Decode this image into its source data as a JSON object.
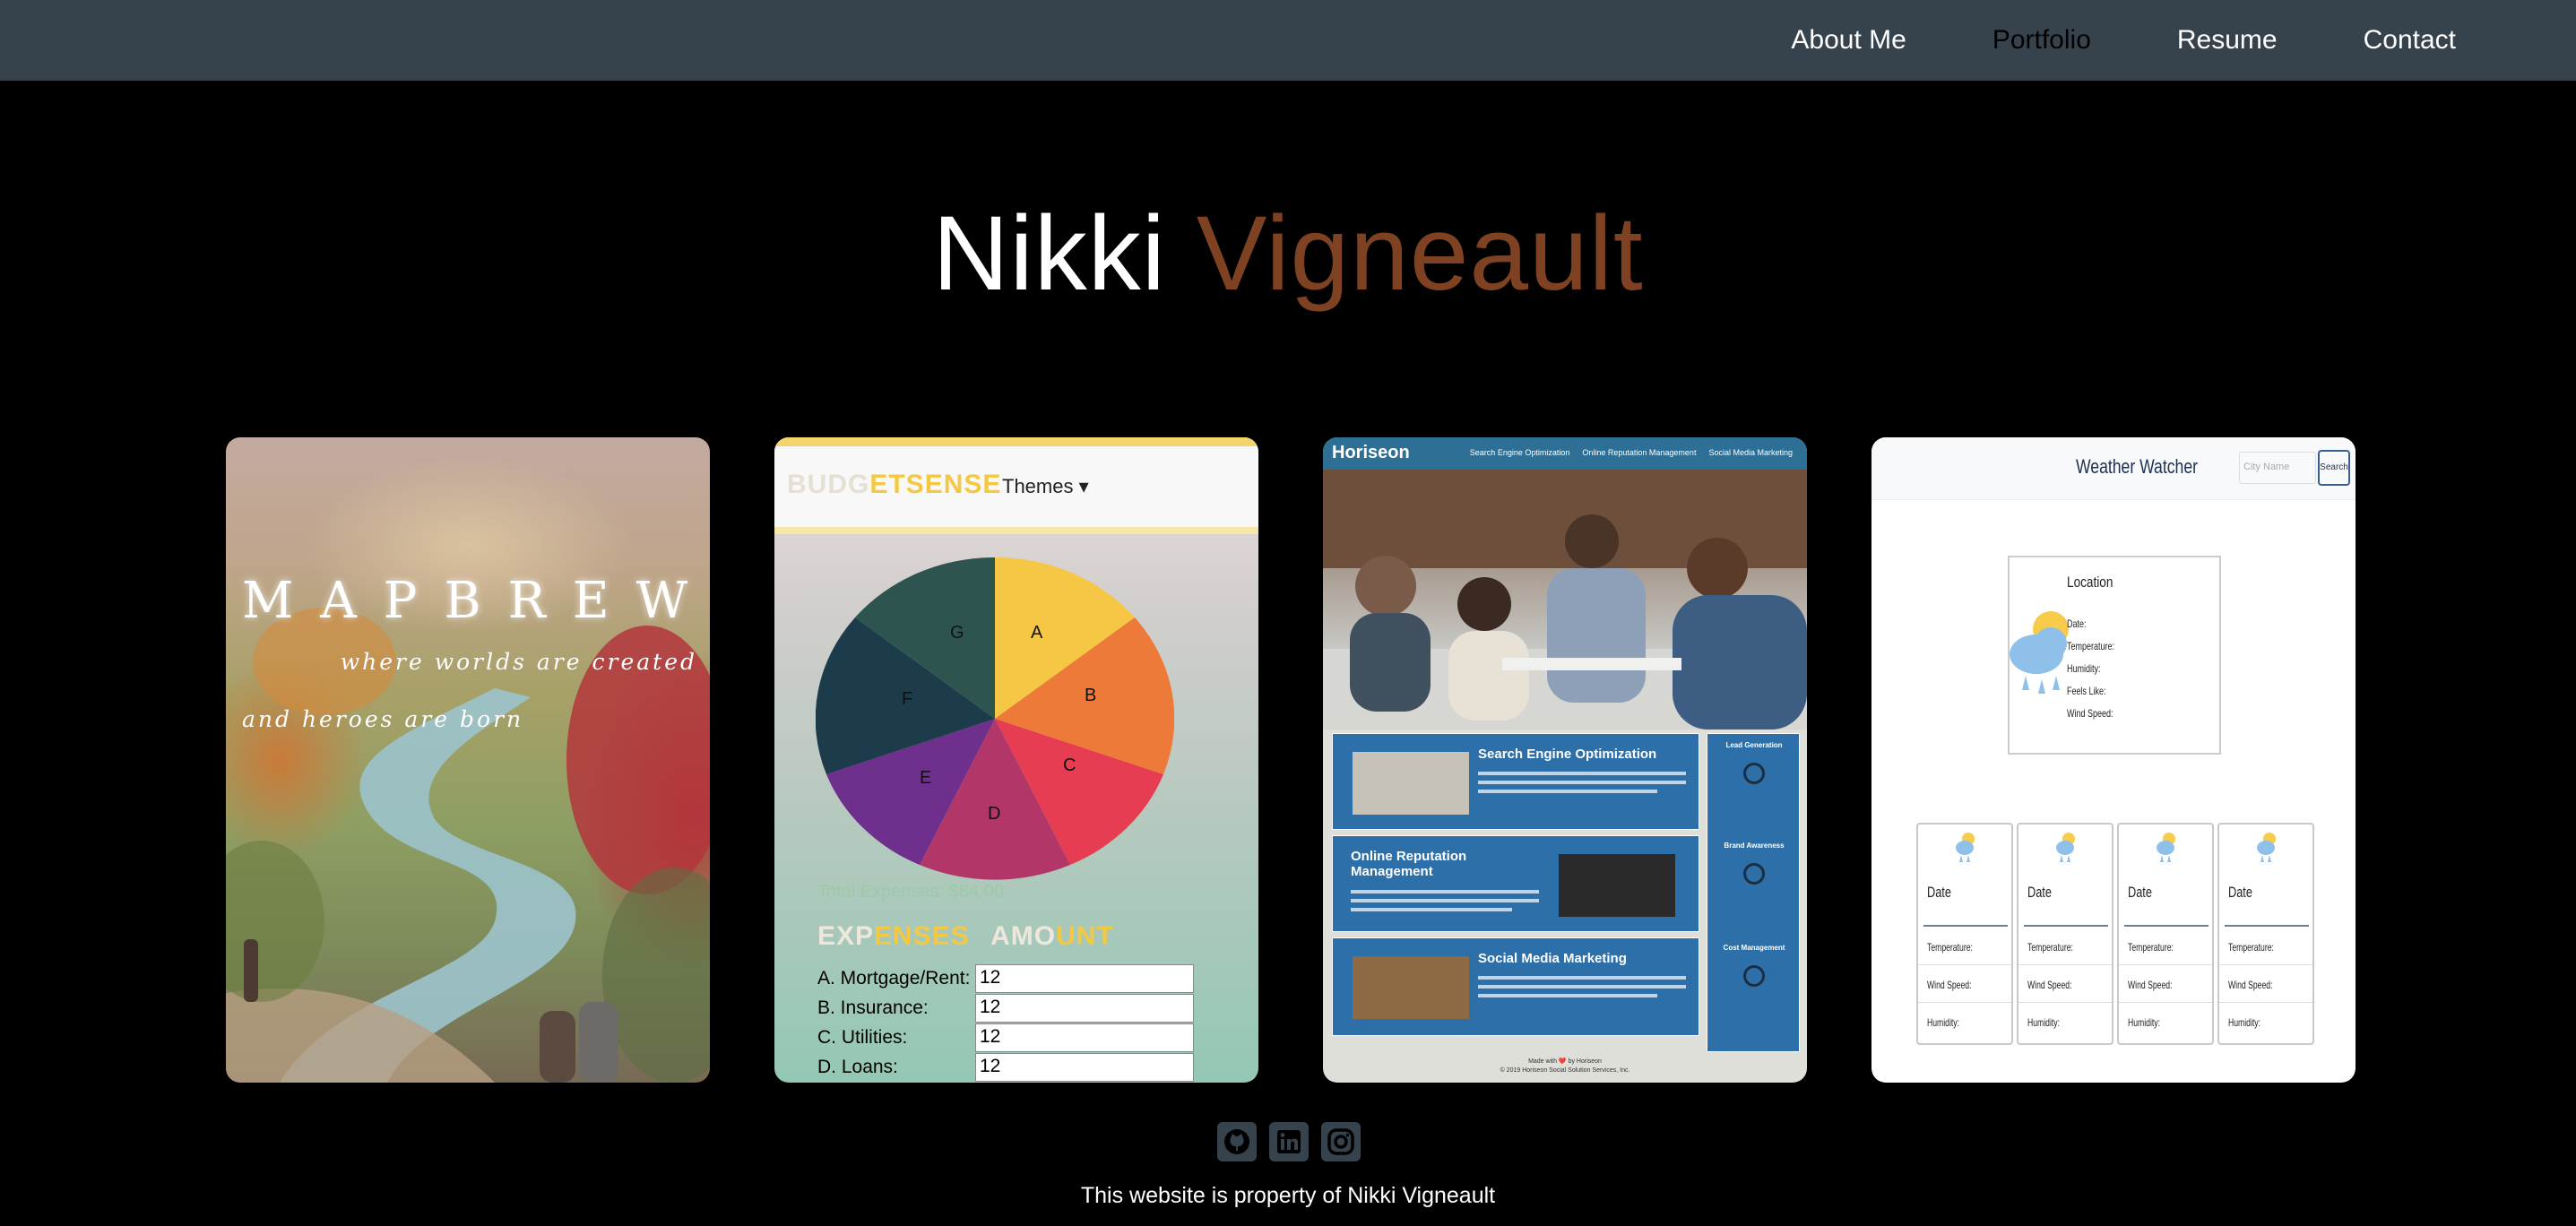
{
  "nav": {
    "links": [
      {
        "label": "About Me"
      },
      {
        "label": "Portfolio"
      },
      {
        "label": "Resume"
      },
      {
        "label": "Contact"
      }
    ]
  },
  "header": {
    "first_name": "Nikki",
    "last_name": "Vigneault"
  },
  "projects": {
    "mapbrew": {
      "title": "MAPBREW",
      "tagline1": "where worlds are created",
      "tagline2": "and heroes are born"
    },
    "budgetsense": {
      "logo_a": "BUDG",
      "logo_b": "ETSENSE",
      "themes_label": "Themes ▾",
      "pie_labels": [
        "A",
        "B",
        "C",
        "D",
        "E",
        "F",
        "G"
      ],
      "total": "Total Expenses: $84.00",
      "expenses_heading_a": "EXP",
      "expenses_heading_b": "ENSES",
      "amount_heading_a": "AMO",
      "amount_heading_b": "UNT",
      "rows": [
        {
          "label": "A. Mortgage/Rent:",
          "value": "12"
        },
        {
          "label": "B. Insurance:",
          "value": "12"
        },
        {
          "label": "C. Utilities:",
          "value": "12"
        },
        {
          "label": "D. Loans:",
          "value": "12"
        }
      ]
    },
    "horiseon": {
      "logo": "Horiseon",
      "nav": [
        "Search Engine Optimization",
        "Online Reputation Management",
        "Social Media Marketing"
      ],
      "sections": [
        "Search Engine Optimization",
        "Online Reputation Management",
        "Social Media Marketing"
      ],
      "side": [
        "Lead Generation",
        "Brand Awareness",
        "Cost Management"
      ],
      "footer1": "Made with ❤️ by Horiseon",
      "footer2": "© 2019 Horiseon Social Solution Services, Inc."
    },
    "weather": {
      "title": "Weather Watcher",
      "search_placeholder": "City Name",
      "search_button": "Search",
      "location": "Location",
      "fields": [
        "Date:",
        "Temperature:",
        "Humidity:",
        "Feels Like:",
        "Wind Speed:"
      ],
      "forecast_date": "Date",
      "forecast_fields": [
        "Temperature:",
        "Wind Speed:",
        "Humidity:"
      ]
    }
  },
  "socials": [
    {
      "icon": "github-icon"
    },
    {
      "icon": "linkedin-icon"
    },
    {
      "icon": "instagram-icon"
    }
  ],
  "footer": {
    "text": "This website is property of Nikki Vigneault"
  },
  "colors": {
    "nav_bg": "#37434c",
    "accent": "#7e4222",
    "background": "#000000"
  }
}
